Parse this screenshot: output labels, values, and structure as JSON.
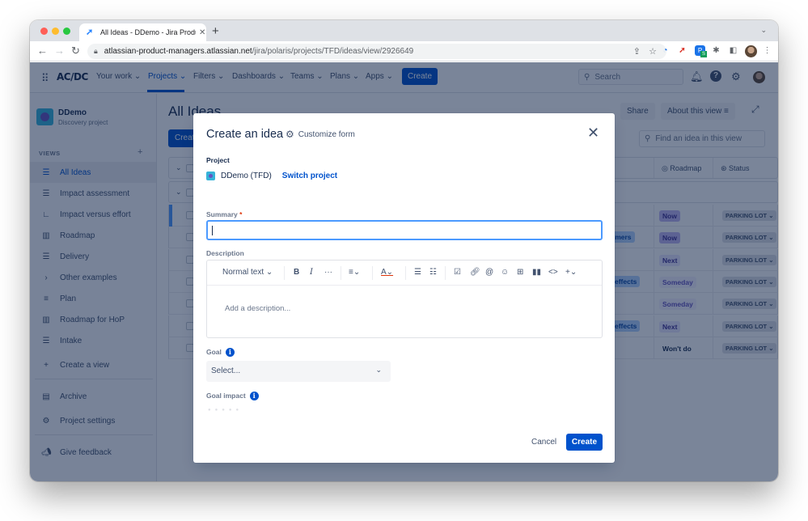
{
  "browser": {
    "tab_title": "All Ideas - DDemo - Jira Product Discovery",
    "url_host": "atlassian-product-managers.atlassian.net",
    "url_path": "/jira/polaris/projects/TFD/ideas/view/2926649",
    "extension_badge": "S"
  },
  "topnav": {
    "logo": "AC/DC",
    "items": [
      "Your work",
      "Projects",
      "Filters",
      "Dashboards",
      "Teams",
      "Plans",
      "Apps"
    ],
    "active_item": "Projects",
    "create_label": "Create",
    "search_placeholder": "Search"
  },
  "sidebar": {
    "project_name": "DDemo",
    "project_type": "Discovery project",
    "views_label": "VIEWS",
    "items": [
      {
        "label": "All Ideas",
        "icon": "list-icon",
        "active": true
      },
      {
        "label": "Impact assessment",
        "icon": "list-icon"
      },
      {
        "label": "Impact versus effort",
        "icon": "matrix-icon"
      },
      {
        "label": "Roadmap",
        "icon": "board-icon"
      },
      {
        "label": "Delivery",
        "icon": "list-icon"
      },
      {
        "label": "Other examples",
        "icon": "chevron-right-icon"
      },
      {
        "label": "Plan",
        "icon": "timeline-icon"
      },
      {
        "label": "Roadmap for HoP",
        "icon": "board-icon"
      },
      {
        "label": "Intake",
        "icon": "list-icon"
      },
      {
        "label": "Create a view",
        "icon": "plus-icon"
      }
    ],
    "archive": "Archive",
    "project_settings": "Project settings",
    "give_feedback": "Give feedback"
  },
  "content": {
    "title": "All Ideas",
    "create_label": "Create",
    "share": "Share",
    "about": "About this view",
    "find_placeholder": "Find an idea in this view",
    "columns": {
      "roadmap": "Roadmap",
      "status": "Status"
    },
    "rows": [
      {
        "tag": "",
        "roadmap": "Now",
        "status": "PARKING LOT"
      },
      {
        "tag": "omers",
        "roadmap": "Now",
        "status": "PARKING LOT"
      },
      {
        "tag": "",
        "roadmap": "Next",
        "status": "PARKING LOT"
      },
      {
        "tag": "effects",
        "roadmap": "Someday",
        "status": "PARKING LOT"
      },
      {
        "tag": "",
        "roadmap": "Someday",
        "status": "PARKING LOT"
      },
      {
        "tag": "effects",
        "roadmap": "Next",
        "status": "PARKING LOT"
      },
      {
        "tag": "",
        "roadmap": "Won't do",
        "status": "PARKING LOT"
      }
    ]
  },
  "modal": {
    "title": "Create an idea",
    "customize": "Customize form",
    "project_label": "Project",
    "project_value": "DDemo (TFD)",
    "switch_project": "Switch project",
    "summary_label": "Summary",
    "summary_value": "",
    "description_label": "Description",
    "text_style": "Normal text",
    "description_placeholder": "Add a description...",
    "goal_label": "Goal",
    "goal_placeholder": "Select...",
    "goal_impact_label": "Goal impact",
    "goal_impact_rating": 0,
    "goal_impact_max": 5,
    "cancel": "Cancel",
    "create": "Create"
  },
  "colors": {
    "brand": "#0052cc",
    "focus": "#4c9aff",
    "required": "#de350b"
  }
}
